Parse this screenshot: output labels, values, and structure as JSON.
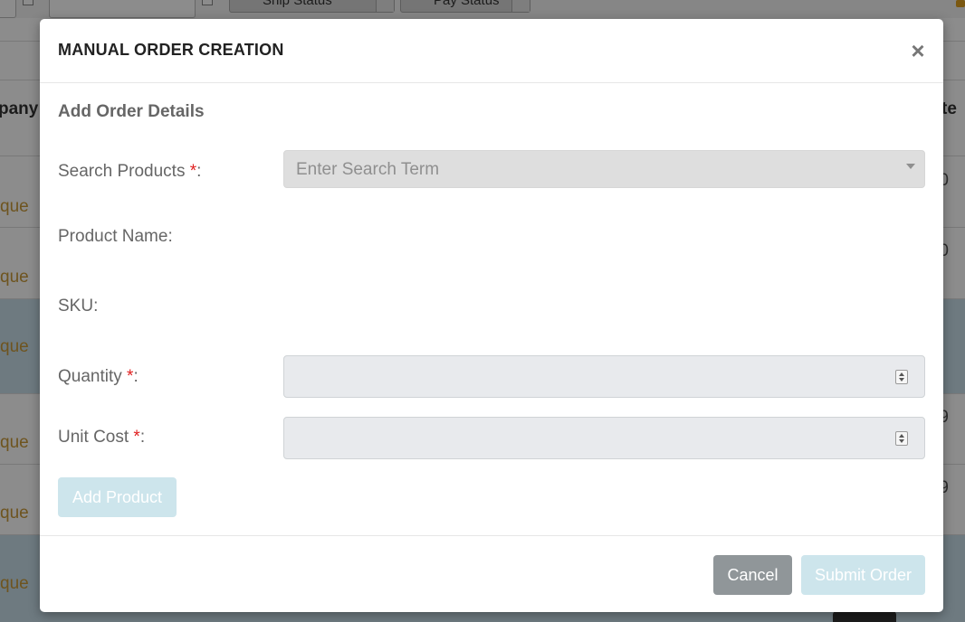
{
  "background": {
    "toolbar": {
      "ship_status_label": "Ship Status",
      "pay_status_label": "Pay Status"
    },
    "table": {
      "company_header": "pany",
      "date_header": "te",
      "rows": [
        {
          "link": "que",
          "value": "0"
        },
        {
          "link": "que",
          "value": "0"
        },
        {
          "link": "que",
          "value": ""
        },
        {
          "link": "que",
          "value": "9"
        },
        {
          "link": "que",
          "value": "9"
        },
        {
          "link": "que",
          "value": ""
        }
      ]
    }
  },
  "modal": {
    "title": "MANUAL ORDER CREATION",
    "close_symbol": "×",
    "section_title": "Add Order Details",
    "required_marker": "*",
    "fields": {
      "search_products": {
        "label": "Search Products ",
        "suffix": ":",
        "placeholder": "Enter Search Term"
      },
      "product_name": {
        "label": "Product Name:"
      },
      "sku": {
        "label": "SKU:"
      },
      "quantity": {
        "label": "Quantity ",
        "suffix": ":",
        "value": ""
      },
      "unit_cost": {
        "label": "Unit Cost ",
        "suffix": ":",
        "value": ""
      }
    },
    "add_product_label": "Add Product",
    "cancel_label": "Cancel",
    "submit_label": "Submit Order"
  },
  "colors": {
    "required": "#e02020",
    "disabled_button": "#cde5ec",
    "cancel_button": "#909699"
  }
}
